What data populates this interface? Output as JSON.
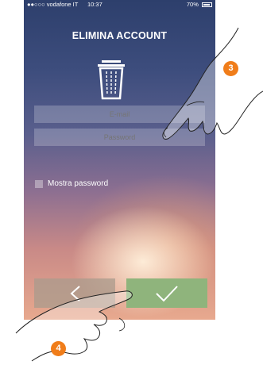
{
  "statusbar": {
    "carrier": "●●○○○ vodafone IT",
    "time": "10:37",
    "battery": "70%"
  },
  "screen": {
    "title": "ELIMINA ACCOUNT",
    "email_placeholder": "E-mail",
    "password_placeholder": "Password",
    "show_password_label": "Mostra password"
  },
  "markers": {
    "step3": "3",
    "step4": "4"
  },
  "colors": {
    "marker": "#f07d1a",
    "confirm_button": "#8fb47c",
    "back_button": "#aa9b8c"
  }
}
